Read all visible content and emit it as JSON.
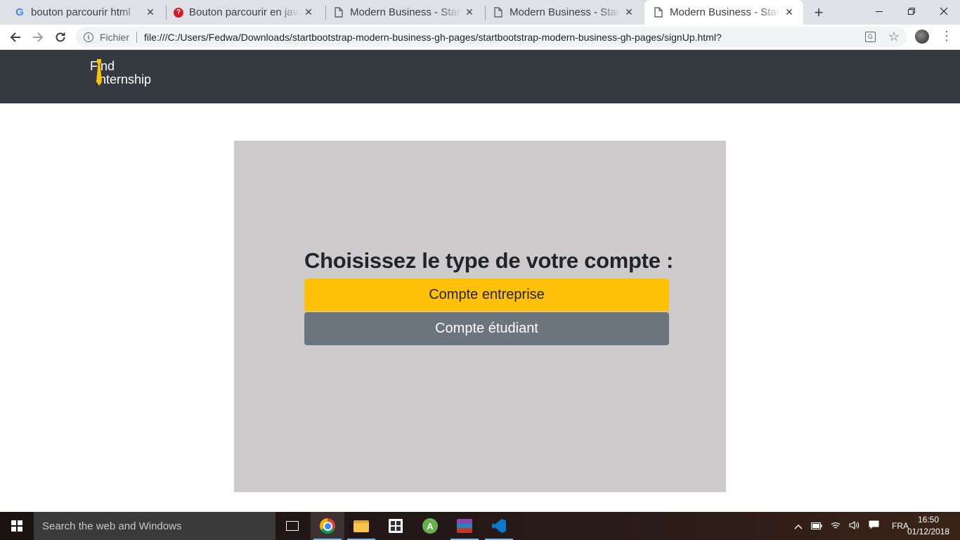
{
  "browser": {
    "tabs": [
      {
        "title": "bouton parcourir html",
        "favicon": "google-icon"
      },
      {
        "title": "Bouton parcourir en javascript",
        "favicon": "pin-icon"
      },
      {
        "title": "Modern Business - Start Bootstrap",
        "favicon": "page-icon"
      },
      {
        "title": "Modern Business - Start Bootstrap",
        "favicon": "page-icon"
      },
      {
        "title": "Modern Business - Start Bootstrap",
        "favicon": "page-icon",
        "active": true
      }
    ],
    "close_glyph": "✕",
    "new_tab_glyph": "+",
    "scheme_label": "Fichier",
    "url": "file:///C:/Users/Fedwa/Downloads/startbootstrap-modern-business-gh-pages/startbootstrap-modern-business-gh-pages/signUp.html?"
  },
  "site": {
    "brand_line1": "Find",
    "brand_line2": "nternship",
    "brand_accent_color": "#ffc107",
    "navbar_color": "#343a40"
  },
  "card": {
    "title": "Choisissez le type de votre compte :",
    "company_button": "Compte entreprise",
    "student_button": "Compte étudiant",
    "background": "#cdcbcc"
  },
  "taskbar": {
    "search_placeholder": "Search the web and Windows",
    "language": "FRA",
    "time": "16:50",
    "date": "01/12/2018",
    "apps": [
      "task-view-icon",
      "chrome-icon",
      "file-explorer-icon",
      "store-icon",
      "android-studio-icon",
      "winrar-icon",
      "vscode-icon"
    ]
  }
}
